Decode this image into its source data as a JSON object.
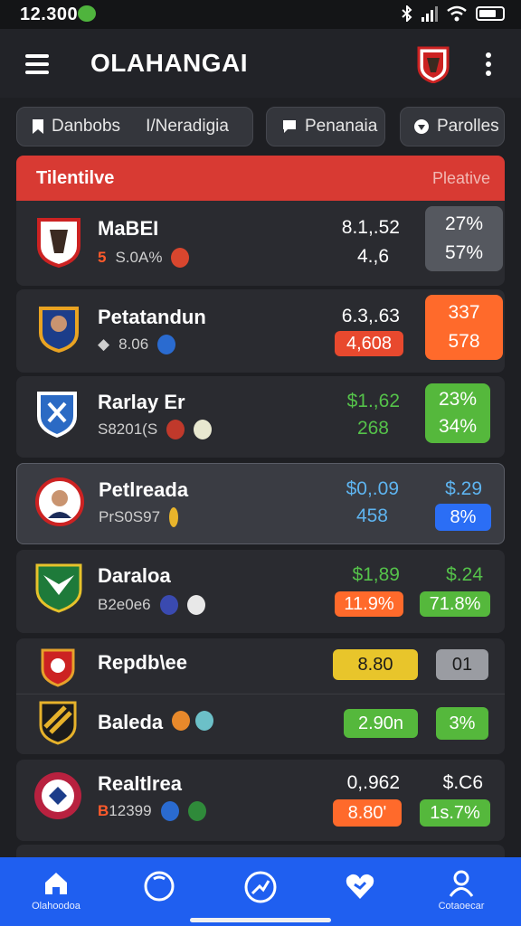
{
  "status": {
    "time": "12.300"
  },
  "app": {
    "title": "OLAHANGAI"
  },
  "filters": [
    {
      "label": "Danbobs",
      "label2": "I/Neradigia"
    },
    {
      "label": "Penanaia"
    },
    {
      "label": "Parolles"
    }
  ],
  "header": {
    "left": "Tilentilve",
    "right": "Pleative"
  },
  "rows": [
    {
      "name": "MaBEI",
      "prefix": "5",
      "sub": "S.0A%",
      "price1": "8.1,.52",
      "price2": "4.,6",
      "box1": "27%",
      "box2": "57%"
    },
    {
      "name": "Petatandun",
      "sub": "8.06",
      "price1": "6.3,.63",
      "price2": "4,608",
      "box1": "337",
      "box2": "578"
    },
    {
      "name": "Rarlay Er",
      "sub": "S8201(S",
      "price1": "$1.,62",
      "price2": "268",
      "box1": "23%",
      "box2": "34%"
    },
    {
      "name": "Petlreada",
      "sub": "PrS0S97",
      "price1": "$0,.09",
      "price2": "458",
      "box1": "$.29",
      "box2": "8%"
    },
    {
      "name": "Daraloa",
      "sub": "B2e0e6",
      "price1": "$1,89",
      "price2": "11.9%",
      "box1": "$.24",
      "box2": "71.8%"
    },
    {
      "name": "Repdb\\ee",
      "pill": "8.80",
      "box": "01"
    },
    {
      "name": "Baleda",
      "pill": "2.90n",
      "box": "3%"
    },
    {
      "name": "Realtlrea",
      "prefix": "B",
      "sub": "12399",
      "price1": "0,.962",
      "price2": "8.80'",
      "box1": "$.C6",
      "box2": "1s.7%"
    }
  ],
  "nav": {
    "left_label": "Olahoodoa",
    "right_label": "Cotaoecar"
  },
  "colors": {
    "accent_red": "#d83a33",
    "orange": "#ff6a2b",
    "green": "#55b83c",
    "blue": "#2b6ef5",
    "yellow": "#e8c52b",
    "nav_blue": "#1f5ff0"
  },
  "icons": [
    "menu-icon",
    "more-icon",
    "home-icon",
    "ball-icon",
    "chart-icon",
    "heart-icon",
    "profile-icon"
  ]
}
